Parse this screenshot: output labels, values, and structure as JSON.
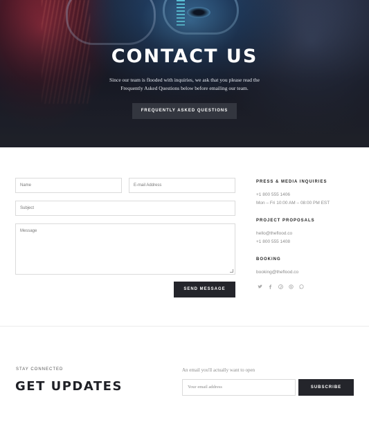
{
  "hero": {
    "title": "CONTACT US",
    "text_line1": "Since our team is flooded with inquiries, we ask that you please read the",
    "text_line2": "Frequently Asked Questions below before emailing our team.",
    "button_label": "FREQUENTLY ASKED QUESTIONS"
  },
  "form": {
    "name_placeholder": "Name",
    "email_placeholder": "E-mail Address",
    "subject_placeholder": "Subject",
    "message_placeholder": "Message",
    "send_label": "SEND MESSAGE"
  },
  "contact": {
    "press_heading": "PRESS & MEDIA INQUIRIES",
    "press_phone": "+1 800 555 1406",
    "press_hours": "Mon – Fri 10:00 AM – 08:00 PM EST",
    "projects_heading": "PROJECT PROPOSALS",
    "projects_email": "hello@theflood.co",
    "projects_phone": "+1 800 555 1408",
    "booking_heading": "BOOKING",
    "booking_email": "booking@theflood.co",
    "social_icons": [
      "twitter-icon",
      "facebook-icon",
      "pinterest-icon",
      "skype-icon",
      "whatsapp-icon"
    ]
  },
  "newsletter": {
    "kicker": "STAY CONNECTED",
    "title": "GET UPDATES",
    "note": "An email you'll actually want to open",
    "input_placeholder": "Your email address",
    "button_label": "SUBSCRIBE"
  },
  "colors": {
    "dark_button": "#24252b",
    "hero_button": "#33363f",
    "muted_text": "#8a8a8a"
  }
}
